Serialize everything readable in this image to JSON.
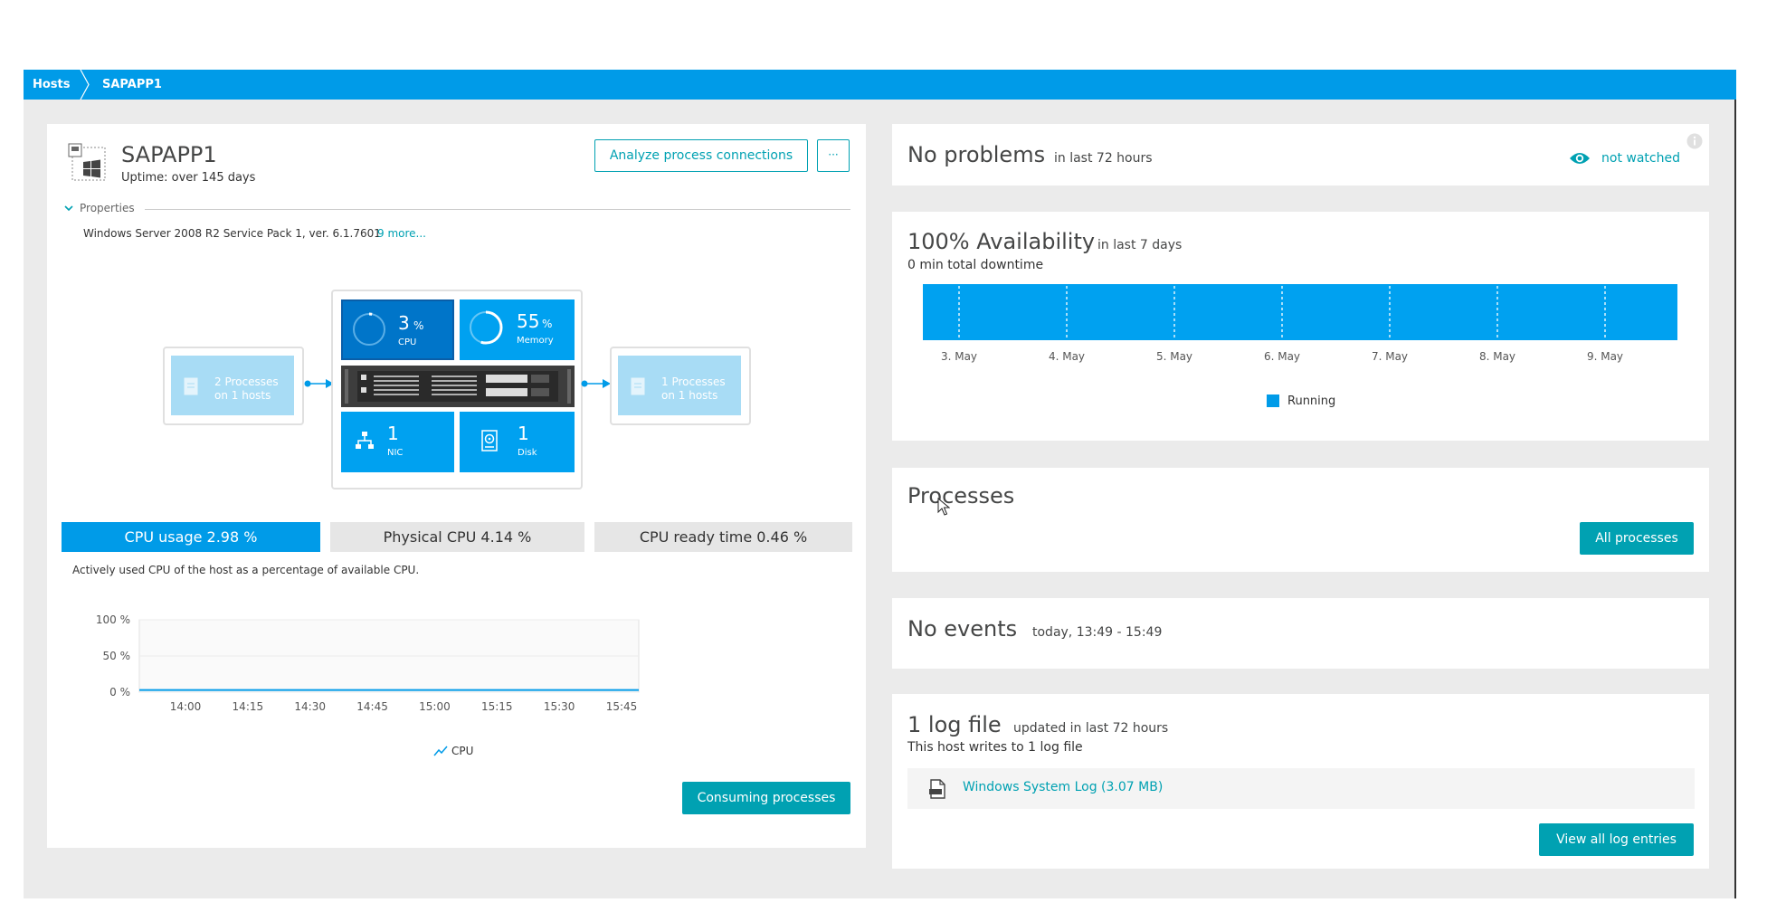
{
  "breadcrumb": {
    "root": "Hosts",
    "current": "SAPAPP1"
  },
  "host": {
    "name": "SAPAPP1",
    "uptime": "Uptime: over 145 days",
    "analyze_label": "Analyze process connections",
    "more_label": "···",
    "properties_label": "Properties",
    "os": "Windows Server 2008 R2 Service Pack 1, ver. 6.1.7601",
    "more_link": "9 more..."
  },
  "topology": {
    "left_processes": {
      "line1": "2 Processes",
      "line2": "on 1 hosts"
    },
    "right_processes": {
      "line1": "1 Processes",
      "line2": "on 1 hosts"
    },
    "cpu": {
      "value": "3",
      "unit": "%",
      "label": "CPU",
      "fill": 0.03
    },
    "memory": {
      "value": "55",
      "unit": "%",
      "label": "Memory",
      "fill": 0.55
    },
    "nic": {
      "value": "1",
      "label": "NIC"
    },
    "disk": {
      "value": "1",
      "label": "Disk"
    }
  },
  "metrics_tabs": [
    {
      "label": "CPU usage 2.98 %",
      "active": true
    },
    {
      "label": "Physical CPU 4.14 %",
      "active": false
    },
    {
      "label": "CPU ready time 0.46 %",
      "active": false
    }
  ],
  "metric_description": "Actively used CPU of the host as a percentage of available CPU.",
  "cpu_chart": {
    "type": "line",
    "y_ticks": [
      "100 %",
      "50 %",
      "0 %"
    ],
    "ylim": [
      0,
      100
    ],
    "x_ticks": [
      "14:00",
      "14:15",
      "14:30",
      "14:45",
      "15:00",
      "15:15",
      "15:30",
      "15:45"
    ],
    "legend": "CPU",
    "values": [
      3,
      3,
      3,
      3,
      3,
      3,
      3,
      3,
      3,
      3,
      3,
      3,
      3,
      3,
      3,
      3,
      3
    ]
  },
  "consuming_label": "Consuming processes",
  "problems": {
    "title": "No problems",
    "period": "in last 72 hours",
    "watch_label": "not watched"
  },
  "availability": {
    "title": "100% Availability",
    "period": "in last 7 days",
    "downtime": "0 min total downtime",
    "days": [
      "3. May",
      "4. May",
      "5. May",
      "6. May",
      "7. May",
      "8. May",
      "9. May"
    ],
    "legend": "Running",
    "color": "#00a1f0"
  },
  "processes": {
    "title": "Processes",
    "button": "All processes"
  },
  "events": {
    "title": "No events",
    "period": "today, 13:49 - 15:49"
  },
  "logs": {
    "title": "1 log file",
    "period": "updated in last 72 hours",
    "subtitle": "This host writes to 1 log file",
    "file": "Windows System Log (3.07 MB)",
    "button": "View all log entries"
  },
  "colors": {
    "brand_blue": "#009be8",
    "teal": "#00a1b2",
    "tile_dark": "#0075c9",
    "tile": "#00a1f0"
  }
}
